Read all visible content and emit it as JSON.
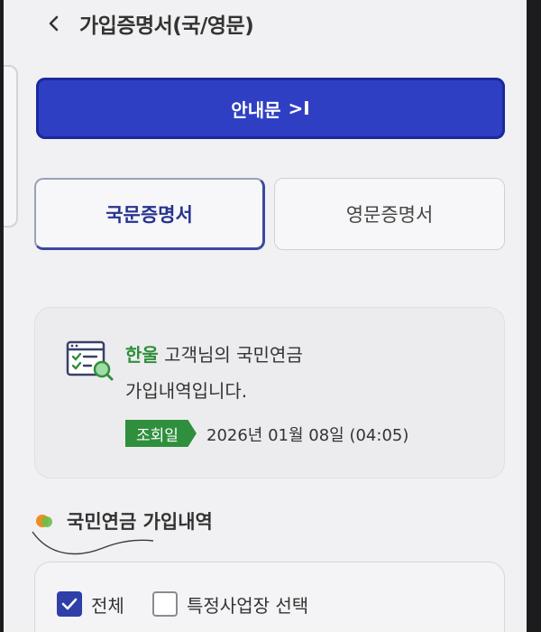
{
  "header": {
    "title": "가입증명서(국/영문)"
  },
  "guide_button": {
    "label": "안내문",
    "arrow": ">I"
  },
  "tabs": [
    {
      "label": "국문증명서",
      "selected": true
    },
    {
      "label": "영문증명서",
      "selected": false
    }
  ],
  "info_card": {
    "customer_name": "한울",
    "line1_suffix": " 고객님의 국민연금",
    "line2": "가입내역입니다.",
    "badge_label": "조회일",
    "date": "2026년 01월 08일 (04:05)"
  },
  "section": {
    "title": "국민연금 가입내역"
  },
  "filters": {
    "all_label": "전체",
    "all_checked": true,
    "specific_label": "특정사업장 선택",
    "specific_checked": false
  },
  "colors": {
    "primary": "#2f3fc4",
    "accent_green": "#2f8f3c",
    "background": "#f1f1f3"
  }
}
